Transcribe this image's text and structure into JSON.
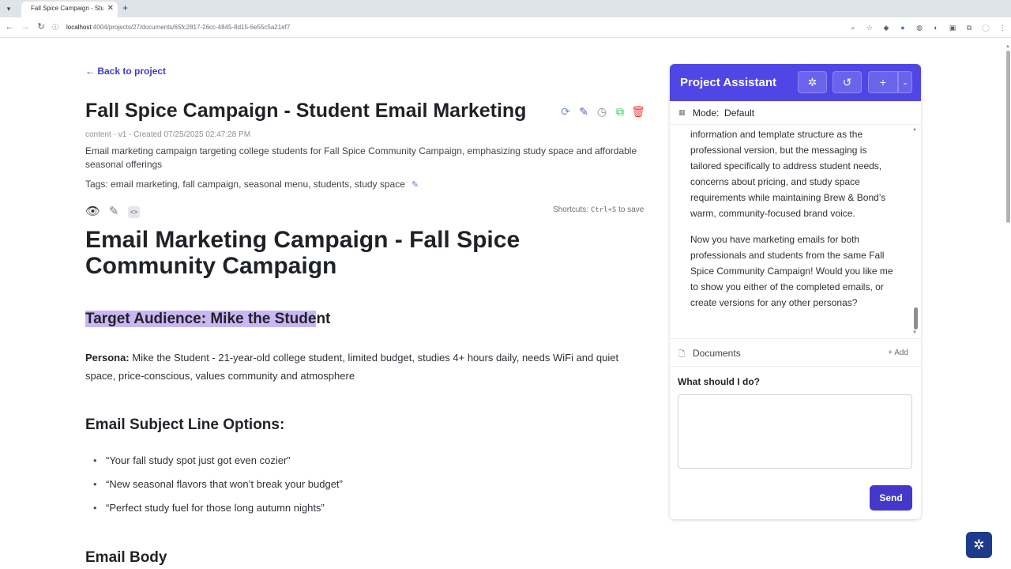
{
  "browser": {
    "tab_title": "Fall Spice Campaign - Stude",
    "url_host": "localhost",
    "url_path": ":4004/projects/27/documents/65fc2817-26cc-4845-8d15-6e55c5a21ef7"
  },
  "doc": {
    "back_label": "Back to project",
    "title": "Fall Spice Campaign - Student Email Marketing",
    "meta": "content - v1 - Created 07/25/2025 02:47:28 PM",
    "description": "Email marketing campaign targeting college students for Fall Spice Community Campaign, emphasizing study space and affordable seasonal offerings",
    "tags": "Tags: email marketing, fall campaign, seasonal menu, students, study space",
    "shortcuts_prefix": "Shortcuts:",
    "shortcuts_key": "Ctrl+S",
    "shortcuts_suffix": "to save"
  },
  "content": {
    "h1": "Email Marketing Campaign - Fall Spice Community Campaign",
    "target_selected": "Target Audience: Mike the Stude",
    "target_rest": "nt",
    "persona_label": "Persona:",
    "persona_text": "Mike the Student - 21-year-old college student, limited budget, studies 4+ hours daily, needs WiFi and quiet space, price-conscious, values community and atmosphere",
    "subject_heading": "Email Subject Line Options:",
    "subject_lines": [
      "“Your fall study spot just got even cozier”",
      "“New seasonal flavors that won’t break your budget”",
      "“Perfect study fuel for those long autumn nights”"
    ],
    "body_heading": "Email Body"
  },
  "assistant": {
    "title": "Project Assistant",
    "mode_label": "Mode:",
    "mode_value": "Default",
    "messages": [
      "information and template structure as the professional version, but the messaging is tailored specifically to address student needs, concerns about pricing, and study space requirements while maintaining Brew & Bond’s warm, community-focused brand voice.",
      "Now you have marketing emails for both professionals and students from the same Fall Spice Community Campaign! Would you like me to show you either of the completed emails, or create versions for any other personas?"
    ],
    "documents_label": "Documents",
    "add_label": "Add",
    "ask_label": "What should I do?",
    "input_value": "",
    "send_label": "Send"
  },
  "colors": {
    "accent": "#4f46e5",
    "send": "#4338ca",
    "highlight": "#c9b6f2",
    "delete": "#ef4444",
    "copy": "#22c55e"
  }
}
